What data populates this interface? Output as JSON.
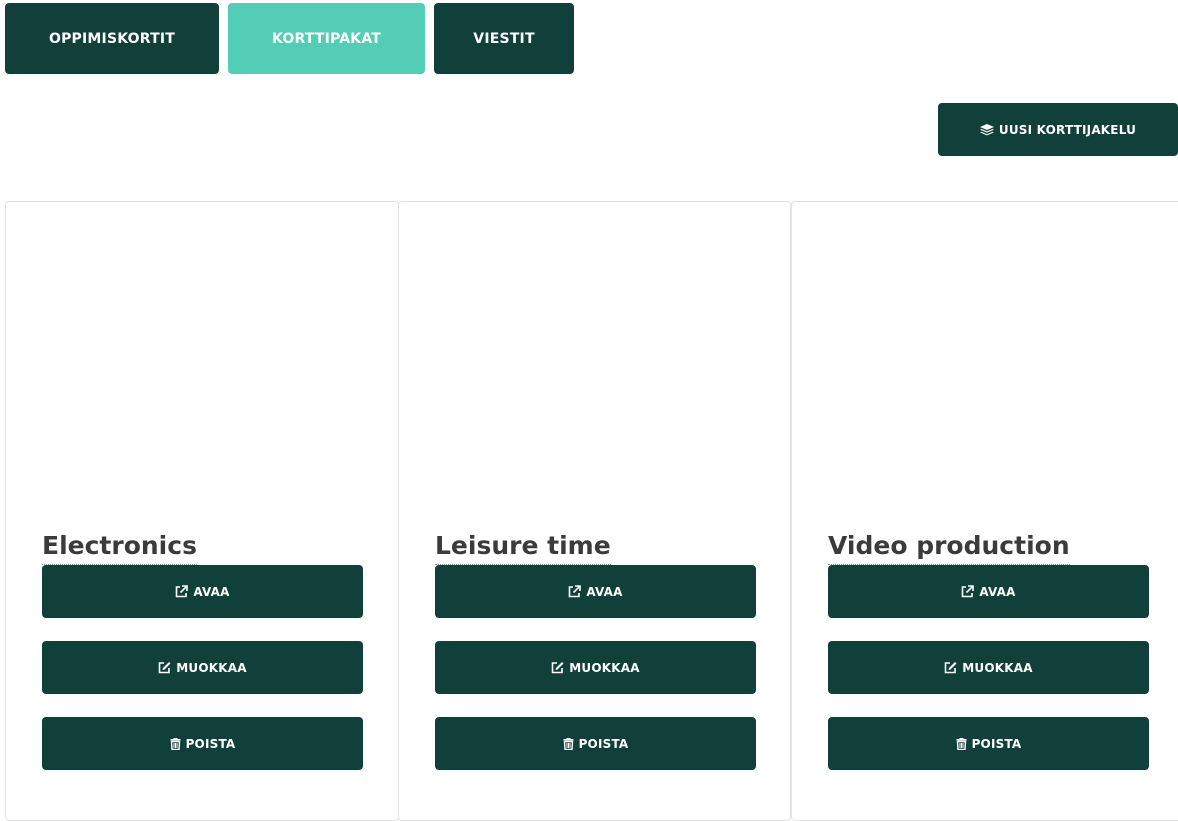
{
  "tabs": [
    {
      "label": "OPPIMISKORTIT",
      "active": false
    },
    {
      "label": "KORTTIPAKAT",
      "active": true
    },
    {
      "label": "VIESTIT",
      "active": false
    }
  ],
  "new_deal_button": {
    "label": "UUSI KORTTIJAKELU",
    "icon": "layers-icon"
  },
  "cards": [
    {
      "title": "Electronics",
      "open_label": "AVAA",
      "edit_label": "MUOKKAA",
      "delete_label": "POISTA"
    },
    {
      "title": "Leisure time",
      "open_label": "AVAA",
      "edit_label": "MUOKKAA",
      "delete_label": "POISTA"
    },
    {
      "title": "Video production",
      "open_label": "AVAA",
      "edit_label": "MUOKKAA",
      "delete_label": "POISTA"
    }
  ],
  "colors": {
    "primary": "#11403a",
    "active_tab": "#53cdb6",
    "title_text": "#3b3b3b",
    "card_border": "#e2e2e2"
  }
}
